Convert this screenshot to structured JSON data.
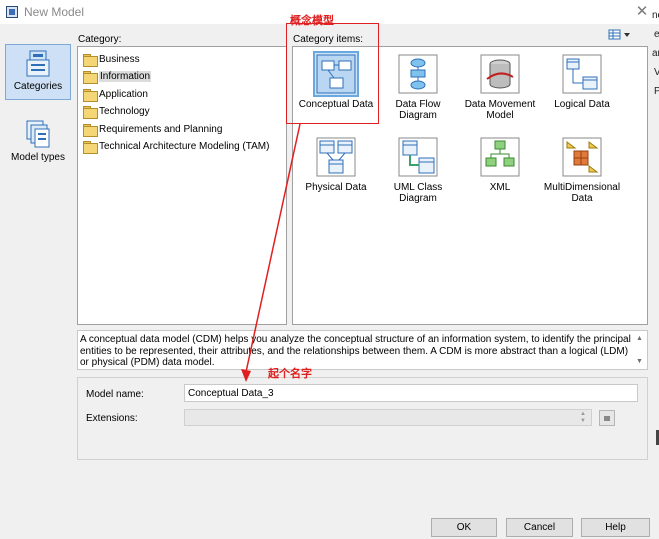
{
  "window": {
    "title": "New Model",
    "close_glyph": "✕"
  },
  "viewbar": {
    "items": [
      {
        "label": "Categories",
        "icon": "categories-icon",
        "selected": true
      },
      {
        "label": "Model types",
        "icon": "model-types-icon",
        "selected": false
      }
    ]
  },
  "category": {
    "label": "Category:",
    "items": [
      {
        "label": "Business",
        "selected": false
      },
      {
        "label": "Information",
        "selected": true
      },
      {
        "label": "Application",
        "selected": false
      },
      {
        "label": "Technology",
        "selected": false
      },
      {
        "label": "Requirements and Planning",
        "selected": false
      },
      {
        "label": "Technical Architecture Modeling (TAM)",
        "selected": false
      }
    ]
  },
  "category_items": {
    "label": "Category items:",
    "view_icon": "list-view-icon",
    "tiles": [
      {
        "label": "Conceptual Data",
        "icon": "conceptual-data-icon",
        "selected": true
      },
      {
        "label": "Data Flow Diagram",
        "icon": "data-flow-diagram-icon",
        "selected": false
      },
      {
        "label": "Data Movement Model",
        "icon": "data-movement-model-icon",
        "selected": false
      },
      {
        "label": "Logical Data",
        "icon": "logical-data-icon",
        "selected": false
      },
      {
        "label": "Physical Data",
        "icon": "physical-data-icon",
        "selected": false
      },
      {
        "label": "UML Class Diagram",
        "icon": "uml-class-diagram-icon",
        "selected": false
      },
      {
        "label": "XML",
        "icon": "xml-icon",
        "selected": false
      },
      {
        "label": "MultiDimensional Data",
        "icon": "multidimensional-data-icon",
        "selected": false
      }
    ]
  },
  "description": "A conceptual data model (CDM) helps you analyze the conceptual structure of an information system, to identify the principal entities to be represented, their attributes, and the relationships between them. A CDM is more abstract than a logical (LDM) or physical (PDM) data model.",
  "form": {
    "model_name_label": "Model name:",
    "model_name_value": "Conceptual Data_3",
    "extensions_label": "Extensions:",
    "extensions_value": ""
  },
  "buttons": {
    "ok": "OK",
    "cancel": "Cancel",
    "help": "Help"
  },
  "annotations": {
    "label_1": "概念模型",
    "label_2": "起个名字",
    "color": "#e02020"
  },
  "background_peek": [
    "ne",
    "e",
    "an",
    "V",
    "P"
  ],
  "colors": {
    "selection": "#cde0f5",
    "accent": "#3c6db3"
  }
}
